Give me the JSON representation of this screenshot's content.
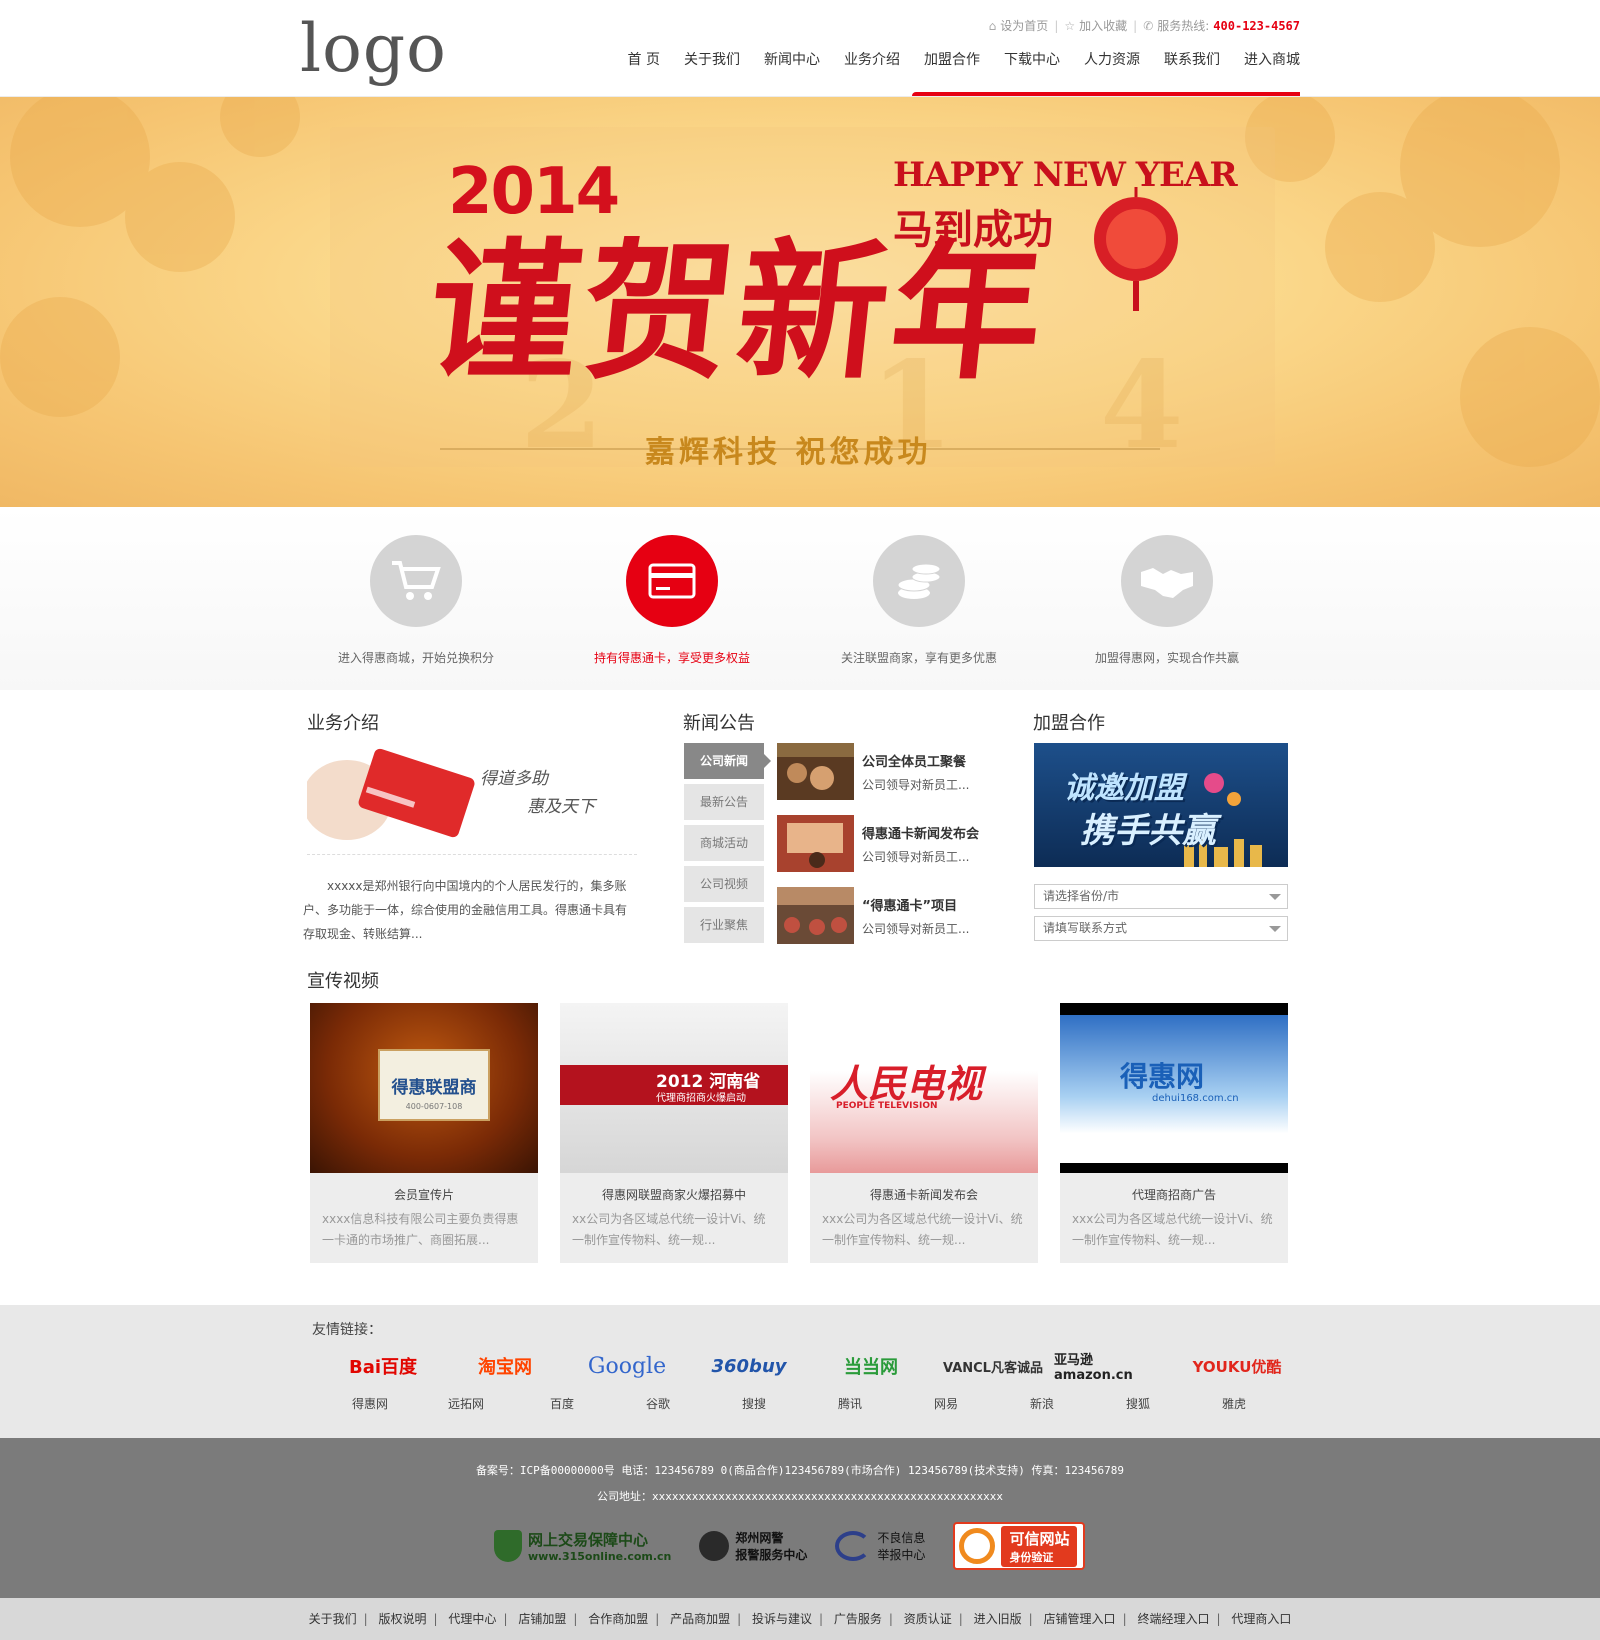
{
  "header": {
    "logo": "logo",
    "set_home": "设为首页",
    "favorite": "加入收藏",
    "hotline_label": "服务热线:",
    "hotline": "400-123-4567",
    "nav": [
      "首 页",
      "关于我们",
      "新闻中心",
      "业务介绍",
      "加盟合作",
      "下载中心",
      "人力资源",
      "联系我们",
      "进入商城"
    ],
    "accent_color": "#e60012"
  },
  "banner": {
    "year": "2014",
    "happy_new_year": "HAPPY NEW YEAR",
    "subtitle": "马到成功",
    "main": "谨贺新年",
    "slogan": "嘉辉科技 祝您成功"
  },
  "features": [
    {
      "icon": "cart-icon",
      "text": "进入得惠商城，开始兑换积分",
      "active": false
    },
    {
      "icon": "card-icon",
      "text": "持有得惠通卡，享受更多权益",
      "active": true
    },
    {
      "icon": "coins-icon",
      "text": "关注联盟商家，享有更多优惠",
      "active": false
    },
    {
      "icon": "handshake-icon",
      "text": "加盟得惠网，实现合作共赢",
      "active": false
    }
  ],
  "business": {
    "title": "业务介绍",
    "card_text_1": "得道多助",
    "card_text_2": "惠及天下",
    "desc": "xxxxx是郑州银行向中国境内的个人居民发行的，集多账户、多功能于一体，综合使用的金融信用工具。得惠通卡具有存取现金、转账结算..."
  },
  "news": {
    "title": "新闻公告",
    "tabs": [
      "公司新闻",
      "最新公告",
      "商城活动",
      "公司视频",
      "行业聚焦"
    ],
    "items": [
      {
        "title": "公司全体员工聚餐",
        "summary": "公司领导对新员工..."
      },
      {
        "title": "得惠通卡新闻发布会",
        "summary": "公司领导对新员工..."
      },
      {
        "title": "“得惠通卡”项目",
        "summary": "公司领导对新员工..."
      }
    ]
  },
  "join": {
    "title": "加盟合作",
    "img_text_1": "诚邀加盟",
    "img_text_2": "携手共赢",
    "province_placeholder": "请选择省份/市",
    "contact_placeholder": "请填写联系方式"
  },
  "videos": {
    "title": "宣传视频",
    "items": [
      {
        "title": "会员宣传片",
        "desc": "xxxx信息科技有限公司主要负责得惠一卡通的市场推广、商圈拓展...",
        "img_text": "得惠联盟商",
        "img_sub": "400-0607-108"
      },
      {
        "title": "得惠网联盟商家火爆招募中",
        "desc": "xx公司为各区域总代统一设计Vi、统一制作宣传物料、统一规...",
        "img_text": "2012 河南省",
        "img_sub": "代理商招商火爆启动"
      },
      {
        "title": "得惠通卡新闻发布会",
        "desc": "xxx公司为各区域总代统一设计Vi、统一制作宣传物料、统一规...",
        "img_text": "人民电视",
        "img_sub": "PEOPLE TELEVISION"
      },
      {
        "title": "代理商招商广告",
        "desc": "xxx公司为各区域总代统一设计Vi、统一制作宣传物料、统一规...",
        "img_text": "得惠网",
        "img_sub": "dehui168.com.cn"
      }
    ]
  },
  "links": {
    "title": "友情链接：",
    "logos": [
      {
        "name": "Bai百度",
        "color": "#e10601"
      },
      {
        "name": "淘宝网",
        "color": "#ff4400"
      },
      {
        "name": "Google",
        "color": "#3366cc"
      },
      {
        "name": "360buy",
        "color": "#2255aa"
      },
      {
        "name": "当当网",
        "color": "#2a9b3a"
      },
      {
        "name": "VANCL凡客诚品",
        "color": "#333333"
      },
      {
        "name": "亚马逊 amazon.cn",
        "color": "#222222"
      },
      {
        "name": "YOUKU优酷",
        "color": "#e1261c"
      }
    ],
    "names": [
      "得惠网",
      "远拓网",
      "百度",
      "谷歌",
      "搜搜",
      "腾讯",
      "网易",
      "新浪",
      "搜狐",
      "雅虎"
    ]
  },
  "footer": {
    "line1": "备案号：ICP备00000000号 电话：123456789 0(商品合作)123456789(市场合作) 123456789(技术支持) 传真：123456789",
    "line2": "公司地址：xxxxxxxxxxxxxxxxxxxxxxxxxxxxxxxxxxxxxxxxxxxxxxxxxxxxx",
    "badge1_line1": "网上交易保障中心",
    "badge1_line2": "www.315online.com.cn",
    "badge2_line1": "郑州网警",
    "badge2_line2": "报警服务中心",
    "badge3_line1": "不良信息",
    "badge3_line2": "举报中心",
    "badge4_line1": "可信网站",
    "badge4_line2": "身份验证"
  },
  "bottom_nav": [
    "关于我们",
    "版权说明",
    "代理中心",
    "店铺加盟",
    "合作商加盟",
    "产品商加盟",
    "投诉与建议",
    "广告服务",
    "资质认证",
    "进入旧版",
    "店铺管理入口",
    "终端经理入口",
    "代理商入口"
  ]
}
